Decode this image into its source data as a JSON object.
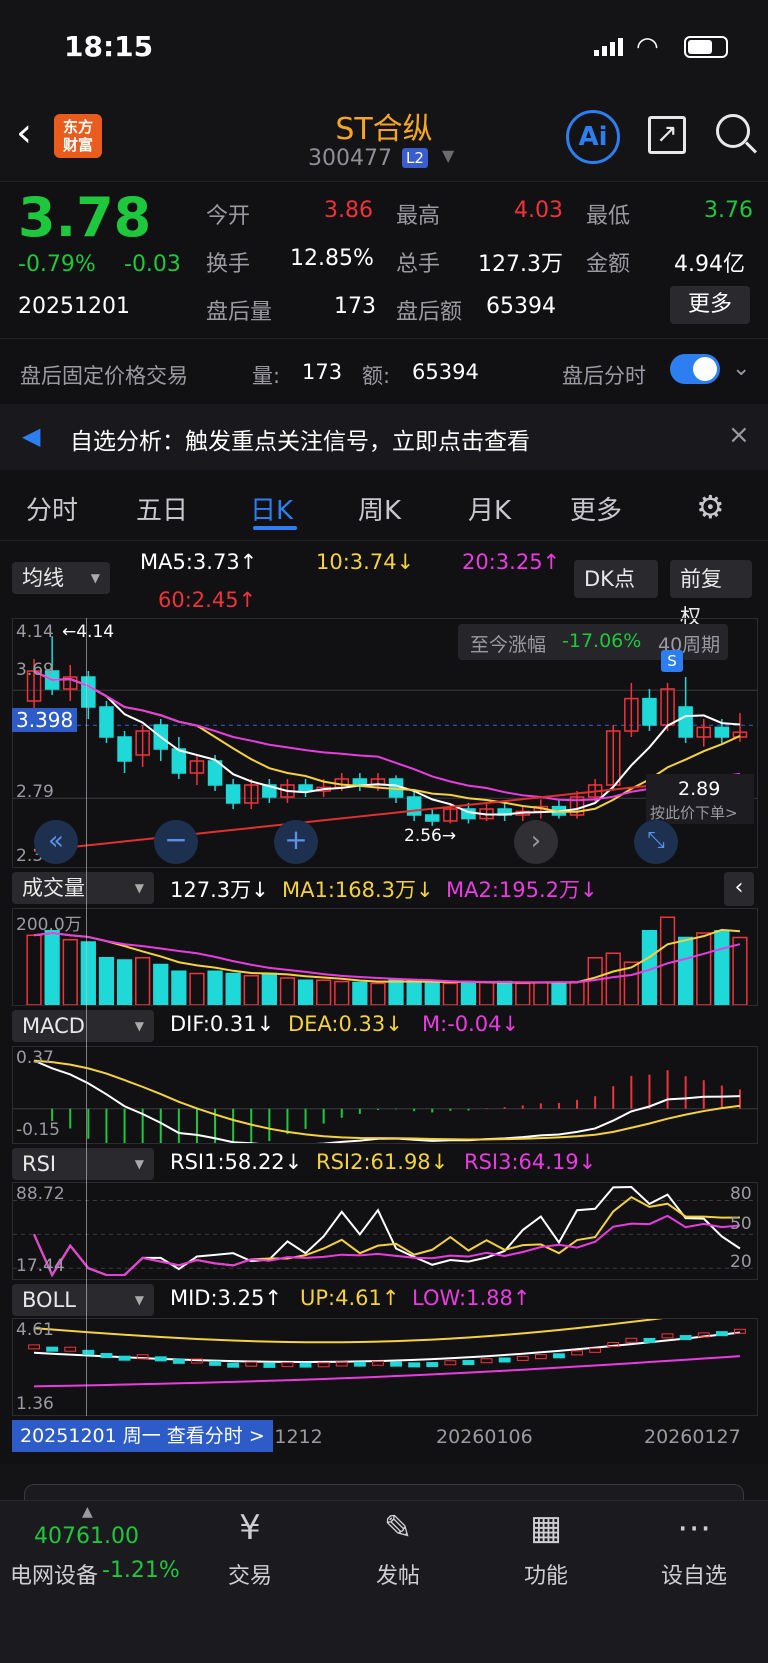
{
  "status_bar": {
    "time": "18:15"
  },
  "header": {
    "logo_text": "东方财富",
    "title": "ST合纵",
    "code": "300477",
    "badge": "L2"
  },
  "quote": {
    "price": "3.78",
    "change_pct": "-0.79%",
    "change": "-0.03",
    "date": "20251201",
    "open_label": "今开",
    "open": "3.86",
    "high_label": "最高",
    "high": "4.03",
    "low_label": "最低",
    "low": "3.76",
    "turnover_label": "换手",
    "turnover": "12.85%",
    "volume_label": "总手",
    "volume": "127.3万",
    "amount_label": "金额",
    "amount": "4.94亿",
    "ah_vol_label": "盘后量",
    "ah_vol": "173",
    "ah_amt_label": "盘后额",
    "ah_amt": "65394",
    "more": "更多"
  },
  "after_hours": {
    "label": "盘后固定价格交易",
    "vol_label": "量:",
    "vol": "173",
    "amt_label": "额:",
    "amt": "65394",
    "toggle_label": "盘后分时",
    "toggle_on": true
  },
  "banner": {
    "text": "自选分析：触发重点关注信号，立即点击查看"
  },
  "tabs": [
    "分时",
    "五日",
    "日K",
    "周K",
    "月K",
    "更多"
  ],
  "active_tab": "日K",
  "ma": {
    "selector": "均线",
    "ma5": "MA5:3.73↑",
    "ma10": "10:3.74↓",
    "ma20": "20:3.25↑",
    "ma60": "60:2.45↑",
    "dk": "DK点",
    "fq": "前复权"
  },
  "kline": {
    "axis": [
      "4.14",
      "3.69",
      "3.398",
      "2.79",
      "2.34"
    ],
    "high_mark": "←4.14",
    "low_mark": "2.56→",
    "range_label": "至今涨幅",
    "range_value": "-17.06%",
    "period": "40周期",
    "sell_mark": "S",
    "price_tag": "2.89",
    "price_tag_hint": "按此价下单>",
    "candles": [
      {
        "o": 3.6,
        "c": 3.85,
        "h": 3.95,
        "l": 3.5
      },
      {
        "o": 3.85,
        "c": 3.7,
        "h": 4.14,
        "l": 3.65
      },
      {
        "o": 3.7,
        "c": 3.8,
        "h": 3.9,
        "l": 3.6
      },
      {
        "o": 3.8,
        "c": 3.55,
        "h": 3.85,
        "l": 3.45
      },
      {
        "o": 3.55,
        "c": 3.3,
        "h": 3.6,
        "l": 3.25
      },
      {
        "o": 3.3,
        "c": 3.1,
        "h": 3.35,
        "l": 3.0
      },
      {
        "o": 3.15,
        "c": 3.35,
        "h": 3.4,
        "l": 3.05
      },
      {
        "o": 3.4,
        "c": 3.2,
        "h": 3.45,
        "l": 3.1
      },
      {
        "o": 3.2,
        "c": 3.0,
        "h": 3.3,
        "l": 2.95
      },
      {
        "o": 3.0,
        "c": 3.1,
        "h": 3.15,
        "l": 2.9
      },
      {
        "o": 3.1,
        "c": 2.9,
        "h": 3.15,
        "l": 2.85
      },
      {
        "o": 2.9,
        "c": 2.75,
        "h": 2.95,
        "l": 2.7
      },
      {
        "o": 2.75,
        "c": 2.9,
        "h": 2.95,
        "l": 2.7
      },
      {
        "o": 2.9,
        "c": 2.8,
        "h": 2.95,
        "l": 2.75
      },
      {
        "o": 2.8,
        "c": 2.9,
        "h": 2.95,
        "l": 2.75
      },
      {
        "o": 2.9,
        "c": 2.85,
        "h": 2.95,
        "l": 2.8
      },
      {
        "o": 2.85,
        "c": 2.88,
        "h": 2.95,
        "l": 2.8
      },
      {
        "o": 2.88,
        "c": 2.95,
        "h": 3.0,
        "l": 2.85
      },
      {
        "o": 2.95,
        "c": 2.9,
        "h": 3.0,
        "l": 2.85
      },
      {
        "o": 2.9,
        "c": 2.95,
        "h": 3.0,
        "l": 2.85
      },
      {
        "o": 2.95,
        "c": 2.8,
        "h": 2.98,
        "l": 2.75
      },
      {
        "o": 2.8,
        "c": 2.65,
        "h": 2.85,
        "l": 2.6
      },
      {
        "o": 2.65,
        "c": 2.6,
        "h": 2.7,
        "l": 2.56
      },
      {
        "o": 2.6,
        "c": 2.7,
        "h": 2.75,
        "l": 2.58
      },
      {
        "o": 2.7,
        "c": 2.62,
        "h": 2.75,
        "l": 2.58
      },
      {
        "o": 2.62,
        "c": 2.7,
        "h": 2.75,
        "l": 2.6
      },
      {
        "o": 2.7,
        "c": 2.65,
        "h": 2.75,
        "l": 2.6
      },
      {
        "o": 2.65,
        "c": 2.68,
        "h": 2.72,
        "l": 2.6
      },
      {
        "o": 2.68,
        "c": 2.72,
        "h": 2.78,
        "l": 2.62
      },
      {
        "o": 2.72,
        "c": 2.65,
        "h": 2.78,
        "l": 2.62
      },
      {
        "o": 2.65,
        "c": 2.8,
        "h": 2.85,
        "l": 2.62
      },
      {
        "o": 2.8,
        "c": 2.9,
        "h": 2.95,
        "l": 2.75
      },
      {
        "o": 2.9,
        "c": 3.35,
        "h": 3.4,
        "l": 2.85
      },
      {
        "o": 3.35,
        "c": 3.62,
        "h": 3.75,
        "l": 3.3
      },
      {
        "o": 3.62,
        "c": 3.4,
        "h": 3.7,
        "l": 3.35
      },
      {
        "o": 3.4,
        "c": 3.7,
        "h": 3.75,
        "l": 3.35
      },
      {
        "o": 3.55,
        "c": 3.3,
        "h": 3.8,
        "l": 3.25
      },
      {
        "o": 3.3,
        "c": 3.38,
        "h": 3.45,
        "l": 3.22
      },
      {
        "o": 3.38,
        "c": 3.3,
        "h": 3.45,
        "l": 3.25
      },
      {
        "o": 3.3,
        "c": 3.34,
        "h": 3.5,
        "l": 3.26
      }
    ]
  },
  "volume": {
    "selector": "成交量",
    "value": "127.3万↓",
    "ma1": "MA1:168.3万↓",
    "ma2": "MA2:195.2万↓",
    "axis_top": "200.0万",
    "bars": [
      1.55,
      1.65,
      1.45,
      1.4,
      1.05,
      1.0,
      1.05,
      0.9,
      0.75,
      0.7,
      0.75,
      0.7,
      0.65,
      0.7,
      0.6,
      0.55,
      0.55,
      0.52,
      0.5,
      0.48,
      0.55,
      0.55,
      0.5,
      0.48,
      0.5,
      0.5,
      0.52,
      0.48,
      0.5,
      0.5,
      0.52,
      1.05,
      1.15,
      0.95,
      1.65,
      1.95,
      1.5,
      1.6,
      1.65,
      1.5
    ]
  },
  "macd": {
    "selector": "MACD",
    "dif": "DIF:0.31↓",
    "dea": "DEA:0.33↓",
    "m": "M:-0.04↓",
    "axis_top": "0.37",
    "axis_bottom": "-0.15"
  },
  "rsi": {
    "selector": "RSI",
    "rsi1": "RSI1:58.22↓",
    "rsi2": "RSI2:61.98↓",
    "rsi3": "RSI3:64.19↓",
    "axis_top": "88.72",
    "axis_bottom": "17.44",
    "levels": [
      "80",
      "50",
      "20"
    ]
  },
  "boll": {
    "selector": "BOLL",
    "mid": "MID:3.25↑",
    "up": "UP:4.61↑",
    "low": "LOW:1.88↑",
    "axis_top": "4.61",
    "axis_bottom": "1.36"
  },
  "date_axis": {
    "cursor": "20251201 周一 查看分时 >",
    "d1": "20251212",
    "d2": "20260106",
    "d3": "20260127"
  },
  "bottom_nav": {
    "index_value": "40761.00",
    "index_name": "电网设备",
    "index_change": "-1.21%",
    "trade": "交易",
    "post": "发帖",
    "func": "功能",
    "watch": "设自选"
  },
  "colors": {
    "up": "#f2323a",
    "down": "#1fd8d8",
    "ma5": "#ffffff",
    "ma10": "#f5d23c",
    "ma20": "#e93ce0",
    "ma60": "#e03030",
    "accent": "#2d7ef0"
  }
}
